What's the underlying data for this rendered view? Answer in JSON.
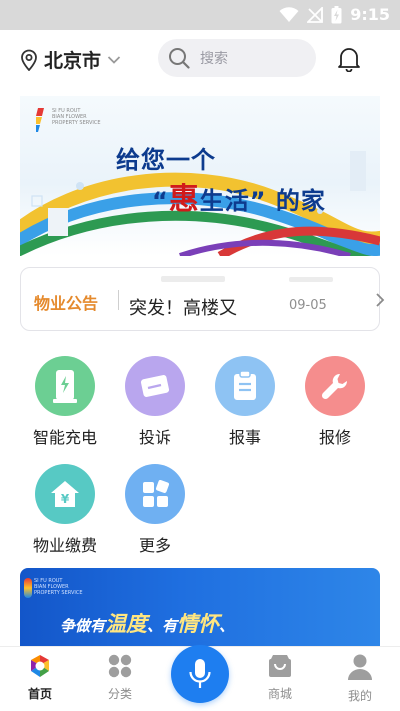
{
  "status_bar": {
    "time": "9:15"
  },
  "header": {
    "city": "北京市",
    "search_placeholder": "搜索"
  },
  "banner": {
    "logo_text": [
      "SI FU ROUT",
      "BIAN FLOWER",
      "PROPERTY SERVICE"
    ],
    "line1": "给您一个",
    "line2_prefix": "“",
    "line2_highlight": "惠",
    "line2_suffix": "生活” 的家"
  },
  "notice": {
    "label": "物业公告",
    "text": "突发！高楼又",
    "date": "09-05"
  },
  "services": [
    {
      "label": "智能充电",
      "icon": "charging-pile-icon",
      "color": "#6ccf93"
    },
    {
      "label": "投诉",
      "icon": "complaint-ticket-icon",
      "color": "#b9a6ee"
    },
    {
      "label": "报事",
      "icon": "clipboard-icon",
      "color": "#8ec3f3"
    },
    {
      "label": "报修",
      "icon": "wrench-icon",
      "color": "#f58d8d"
    },
    {
      "label": "物业缴费",
      "icon": "house-yen-icon",
      "color": "#57c9c4"
    },
    {
      "label": "更多",
      "icon": "more-grid-icon",
      "color": "#6fb0f2"
    }
  ],
  "banner2": {
    "logo_text": [
      "SI FU ROUT",
      "BIAN FLOWER",
      "PROPERTY SERVICE"
    ],
    "slogan_part1": "争做有",
    "slogan_big1": "温度",
    "slogan_part2": "、有",
    "slogan_big2": "情怀",
    "slogan_part3": "、"
  },
  "tabbar": {
    "tabs": [
      {
        "label": "首页",
        "icon": "home-logo-icon",
        "active": true
      },
      {
        "label": "分类",
        "icon": "category-grid-icon",
        "active": false
      },
      {
        "label": "",
        "icon": "microphone-icon",
        "active": false
      },
      {
        "label": "商城",
        "icon": "shopping-bag-icon",
        "active": false
      },
      {
        "label": "我的",
        "icon": "user-icon",
        "active": false
      }
    ]
  },
  "colors": {
    "accent": "#1e7ef0",
    "notice_label": "#e58a2d",
    "banner_title": "#0d3b8e",
    "banner_highlight": "#d11a1a"
  }
}
